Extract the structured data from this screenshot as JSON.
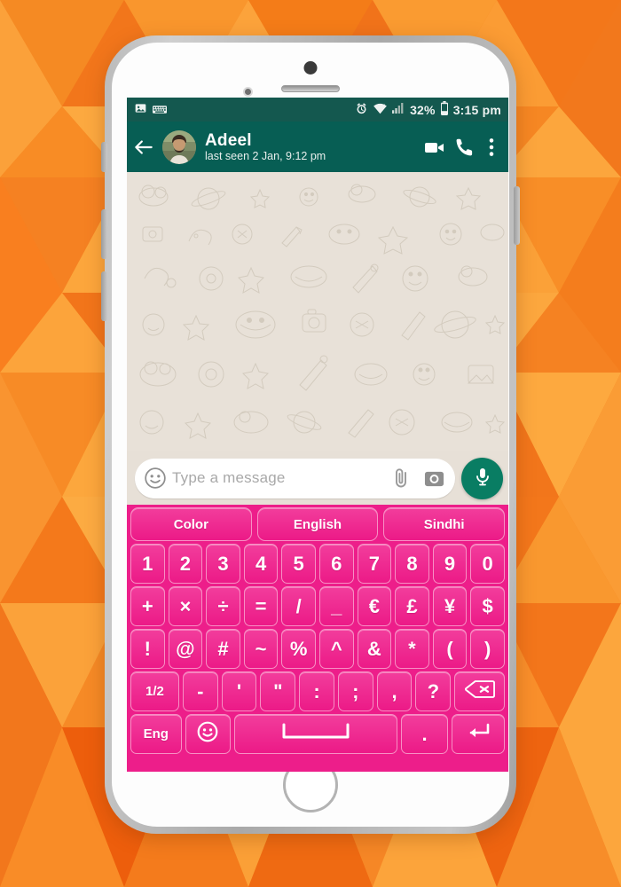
{
  "background": {
    "style": "orange-low-poly-triangles",
    "colors": [
      "#F4741B",
      "#F98B24",
      "#FB9A2E",
      "#E8640F",
      "#FFA63C"
    ]
  },
  "phone": {
    "frame_color": "#b9b9b9",
    "face_color": "#fdfdfd",
    "hardware": {
      "sensor": "proximity-sensor",
      "speaker": "earpiece-speaker",
      "camera": "front-camera",
      "home_button": "home-button",
      "volume_up": "volume-up-button",
      "volume_down": "volume-down-button",
      "power": "power-button"
    }
  },
  "statusbar": {
    "background": "#14584f",
    "left_icons": [
      "image-icon",
      "keyboard-icon"
    ],
    "right_icons": [
      "alarm-icon",
      "wifi-icon",
      "signal-icon",
      "battery-icon"
    ],
    "battery_percent": "32%",
    "time": "3:15 pm"
  },
  "appbar": {
    "background": "#075e54",
    "back_label": "back-arrow",
    "avatar_alt": "Adeel profile photo",
    "contact_name": "Adeel",
    "contact_status": "last seen 2 Jan, 9:12 pm",
    "actions": [
      "video-call-icon",
      "voice-call-icon",
      "overflow-menu-icon"
    ]
  },
  "chat": {
    "wallpaper": "whatsapp-doodle-wallpaper",
    "wallpaper_color": "#e7e0d7",
    "messages": []
  },
  "input_bar": {
    "emoji_icon": "emoji-icon",
    "placeholder": "Type a message",
    "value": "",
    "attach_icon": "paperclip-icon",
    "camera_icon": "camera-icon",
    "mic_icon": "microphone-icon",
    "mic_color": "#097d63"
  },
  "keyboard": {
    "background": "#ED1E8A",
    "key_color": "#f23d9c",
    "key_text_color": "#ffffff",
    "top_row": [
      {
        "label": "Color",
        "name": "key-color"
      },
      {
        "label": "English",
        "name": "key-english"
      },
      {
        "label": "Sindhi",
        "name": "key-sindhi"
      }
    ],
    "rows": [
      {
        "name": "number-row",
        "keys": [
          {
            "label": "1"
          },
          {
            "label": "2"
          },
          {
            "label": "3"
          },
          {
            "label": "4"
          },
          {
            "label": "5"
          },
          {
            "label": "6"
          },
          {
            "label": "7"
          },
          {
            "label": "8"
          },
          {
            "label": "9"
          },
          {
            "label": "0"
          }
        ]
      },
      {
        "name": "symbol-row-1",
        "keys": [
          {
            "label": "+"
          },
          {
            "label": "×"
          },
          {
            "label": "÷"
          },
          {
            "label": "="
          },
          {
            "label": "/"
          },
          {
            "label": "_"
          },
          {
            "label": "€"
          },
          {
            "label": "£"
          },
          {
            "label": "¥"
          },
          {
            "label": "$"
          }
        ]
      },
      {
        "name": "symbol-row-2",
        "keys": [
          {
            "label": "!"
          },
          {
            "label": "@"
          },
          {
            "label": "#"
          },
          {
            "label": "~"
          },
          {
            "label": "%"
          },
          {
            "label": "^"
          },
          {
            "label": "&"
          },
          {
            "label": "*"
          },
          {
            "label": "("
          },
          {
            "label": ")"
          }
        ]
      },
      {
        "name": "symbol-row-3",
        "keys": [
          {
            "label": "1/2"
          },
          {
            "label": "-"
          },
          {
            "label": "'"
          },
          {
            "label": "\""
          },
          {
            "label": ":"
          },
          {
            "label": ";"
          },
          {
            "label": ","
          },
          {
            "label": "?"
          },
          {
            "label": "",
            "icon": "backspace-icon"
          }
        ]
      },
      {
        "name": "bottom-row",
        "keys": [
          {
            "label": "Eng"
          },
          {
            "label": "",
            "icon": "emoji-icon"
          },
          {
            "label": "",
            "icon": "spacebar-icon"
          },
          {
            "label": "."
          },
          {
            "label": "",
            "icon": "enter-icon"
          }
        ]
      }
    ]
  }
}
